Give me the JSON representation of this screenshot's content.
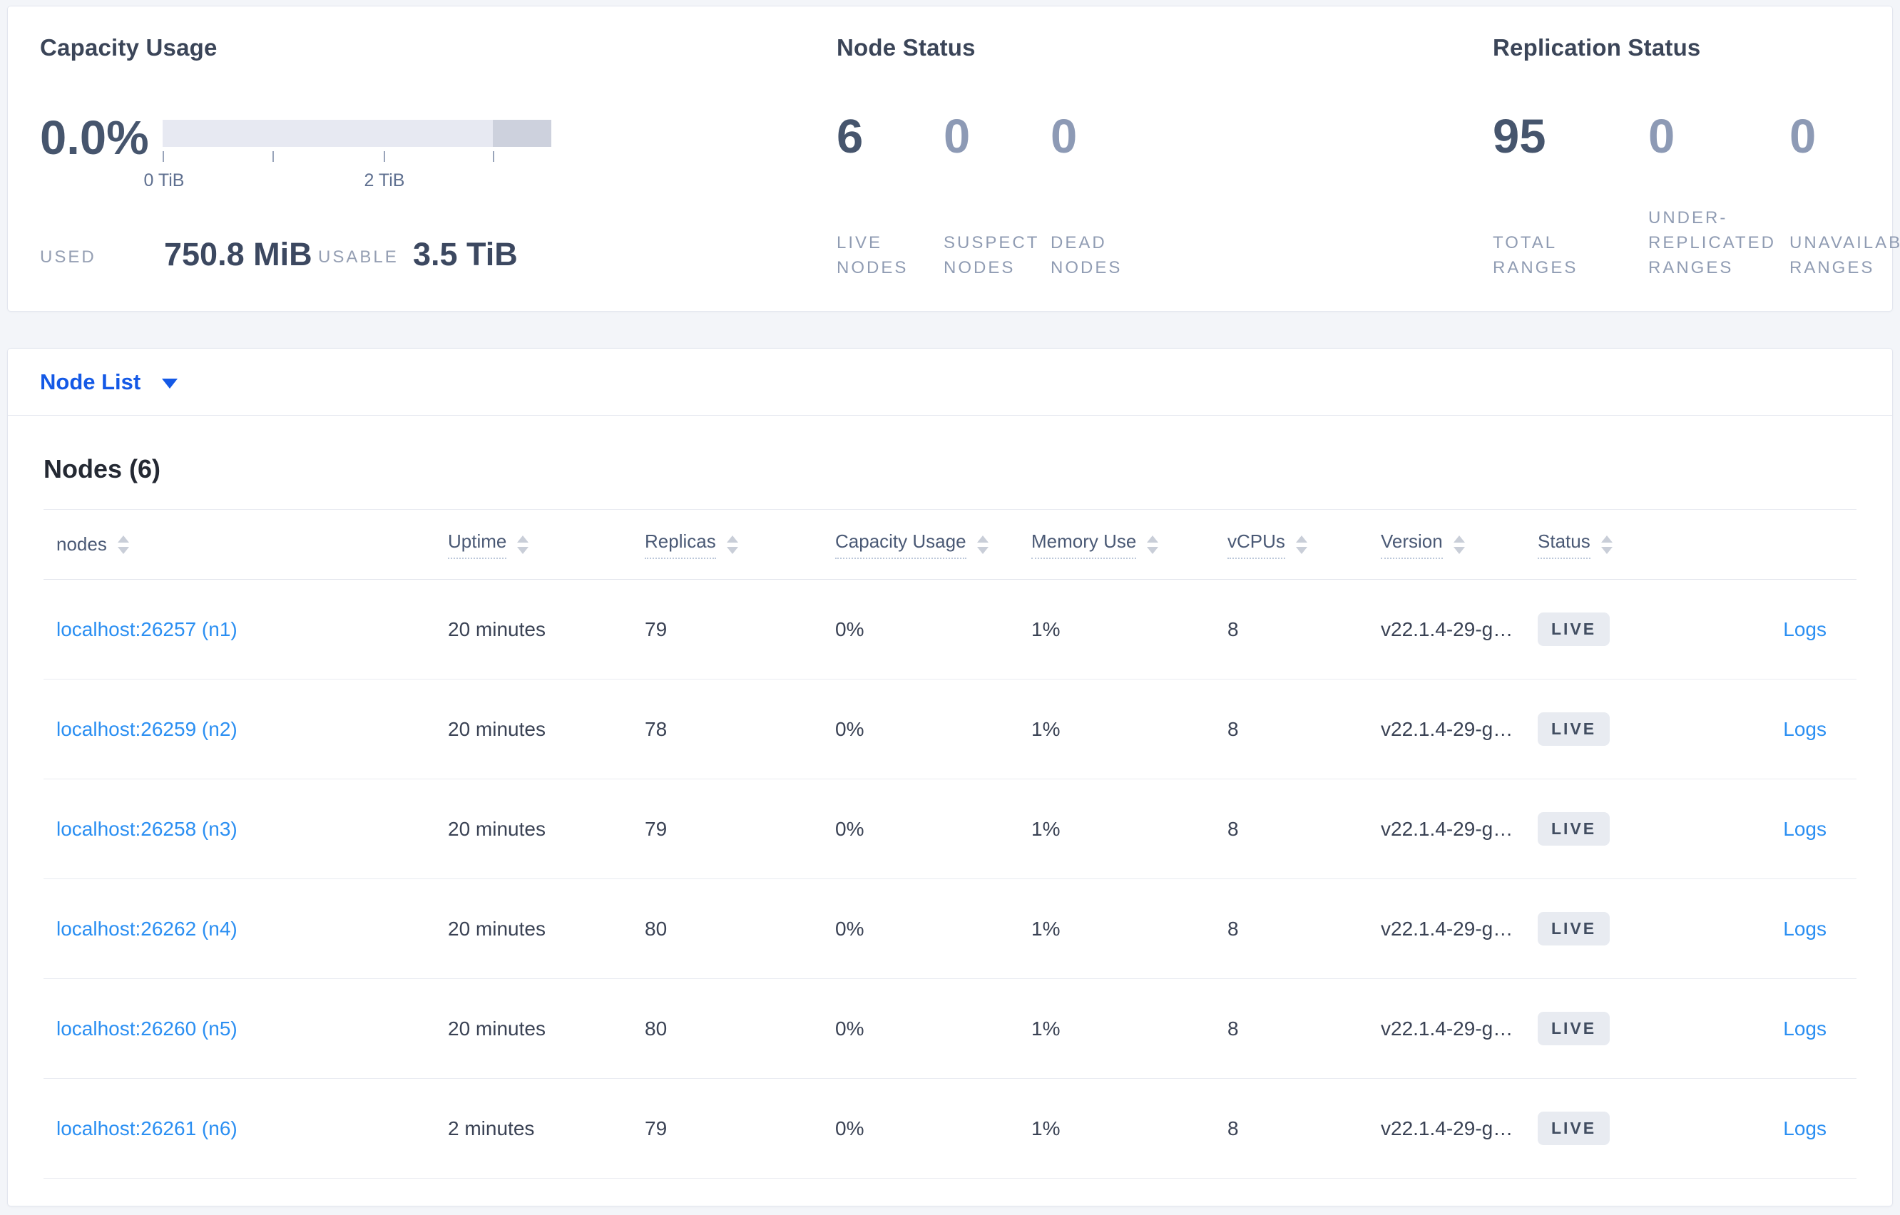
{
  "capacity_panel": {
    "title": "Capacity Usage",
    "percent_used": "0.0%",
    "axis_ticks": [
      "0 TiB",
      "2 TiB"
    ],
    "used_label": "USED",
    "used_value": "750.8 MiB",
    "usable_label": "USABLE",
    "usable_value": "3.5 TiB"
  },
  "node_status_panel": {
    "title": "Node Status",
    "stats": [
      {
        "value": "6",
        "label": "LIVE\nNODES"
      },
      {
        "value": "0",
        "label": "SUSPECT\nNODES"
      },
      {
        "value": "0",
        "label": "DEAD\nNODES"
      }
    ]
  },
  "replication_panel": {
    "title": "Replication Status",
    "stats": [
      {
        "value": "95",
        "label": "TOTAL\nRANGES"
      },
      {
        "value": "0",
        "label": "UNDER-\nREPLICATED\nRANGES"
      },
      {
        "value": "0",
        "label": "UNAVAILABLE\nRANGES"
      }
    ]
  },
  "node_list_selector": {
    "label": "Node List"
  },
  "nodes_table": {
    "heading": "Nodes (6)",
    "columns": [
      {
        "label": "nodes"
      },
      {
        "label": "Uptime"
      },
      {
        "label": "Replicas"
      },
      {
        "label": "Capacity Usage"
      },
      {
        "label": "Memory Use"
      },
      {
        "label": "vCPUs"
      },
      {
        "label": "Version"
      },
      {
        "label": "Status"
      }
    ],
    "rows": [
      {
        "address": "localhost:26257 (n1)",
        "uptime": "20 minutes",
        "replicas": "79",
        "capacity_usage": "0%",
        "memory_use": "1%",
        "vcpus": "8",
        "version": "v22.1.4-29-g…",
        "status": "LIVE",
        "logs_label": "Logs"
      },
      {
        "address": "localhost:26259 (n2)",
        "uptime": "20 minutes",
        "replicas": "78",
        "capacity_usage": "0%",
        "memory_use": "1%",
        "vcpus": "8",
        "version": "v22.1.4-29-g…",
        "status": "LIVE",
        "logs_label": "Logs"
      },
      {
        "address": "localhost:26258 (n3)",
        "uptime": "20 minutes",
        "replicas": "79",
        "capacity_usage": "0%",
        "memory_use": "1%",
        "vcpus": "8",
        "version": "v22.1.4-29-g…",
        "status": "LIVE",
        "logs_label": "Logs"
      },
      {
        "address": "localhost:26262 (n4)",
        "uptime": "20 minutes",
        "replicas": "80",
        "capacity_usage": "0%",
        "memory_use": "1%",
        "vcpus": "8",
        "version": "v22.1.4-29-g…",
        "status": "LIVE",
        "logs_label": "Logs"
      },
      {
        "address": "localhost:26260 (n5)",
        "uptime": "20 minutes",
        "replicas": "80",
        "capacity_usage": "0%",
        "memory_use": "1%",
        "vcpus": "8",
        "version": "v22.1.4-29-g…",
        "status": "LIVE",
        "logs_label": "Logs"
      },
      {
        "address": "localhost:26261 (n6)",
        "uptime": "2 minutes",
        "replicas": "79",
        "capacity_usage": "0%",
        "memory_use": "1%",
        "vcpus": "8",
        "version": "v22.1.4-29-g…",
        "status": "LIVE",
        "logs_label": "Logs"
      }
    ]
  }
}
